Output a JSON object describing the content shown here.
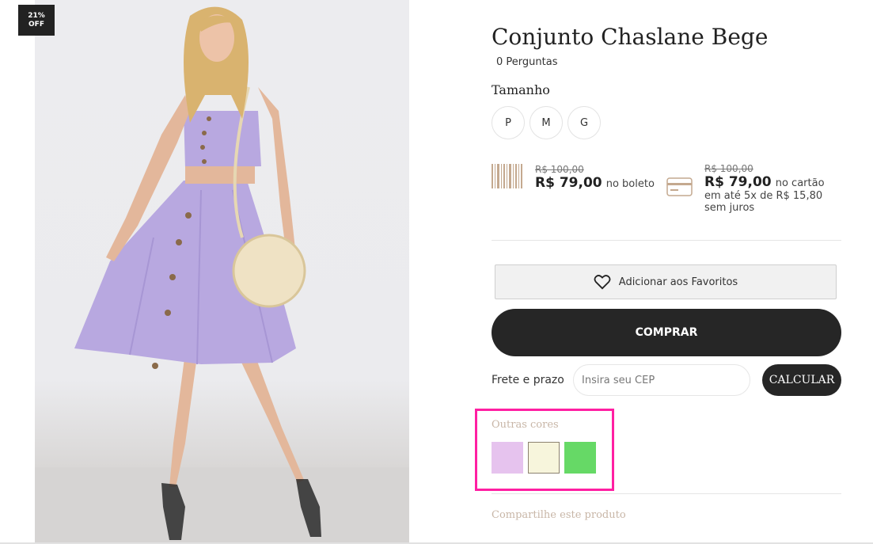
{
  "badge": {
    "line1": "21%",
    "line2": "OFF"
  },
  "product": {
    "title": "Conjunto Chaslane Bege",
    "questions": "0 Perguntas",
    "size_label": "Tamanho",
    "sizes": [
      "P",
      "M",
      "G"
    ]
  },
  "pricing": {
    "boleto": {
      "old_price": "R$ 100,00",
      "price": "R$ 79,00",
      "suffix": "no boleto"
    },
    "card": {
      "old_price": "R$ 100,00",
      "price": "R$ 79,00",
      "suffix": "no cartão",
      "installments": "em até 5x de R$ 15,80",
      "interest": "sem juros"
    }
  },
  "actions": {
    "favorite_label": "Adicionar aos Favoritos",
    "buy_label": "COMPRAR"
  },
  "shipping": {
    "label": "Frete e prazo",
    "placeholder": "Insira seu CEP",
    "calculate_label": "CALCULAR"
  },
  "other_colors": {
    "label": "Outras cores",
    "swatches": [
      {
        "name": "lilac",
        "color": "#e6c3ee"
      },
      {
        "name": "beige",
        "color": "#f7f5dc"
      },
      {
        "name": "green",
        "color": "#66d966"
      }
    ]
  },
  "share_label": "Compartilhe este produto",
  "colors": {
    "highlight": "#ff1fa2",
    "dark_button": "#262626",
    "muted_text": "#c8b6a7"
  }
}
